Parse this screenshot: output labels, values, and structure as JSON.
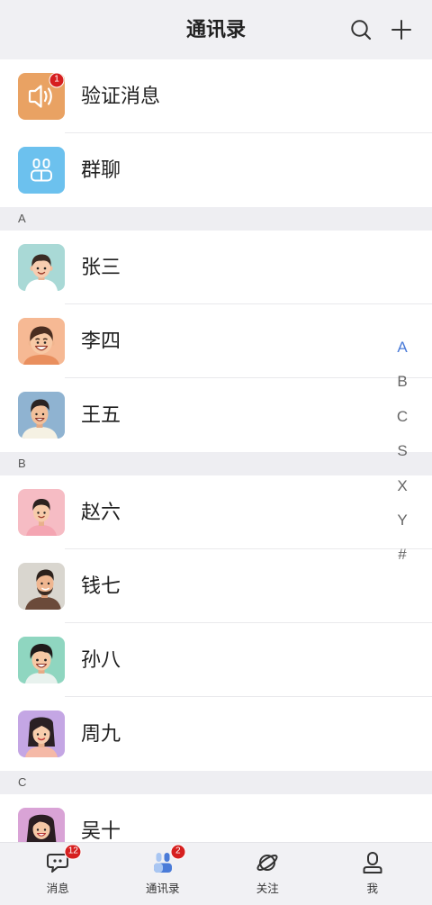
{
  "header": {
    "title": "通讯录",
    "search_icon": "search-icon",
    "add_icon": "plus-icon"
  },
  "special_items": [
    {
      "label": "验证消息",
      "badge": "1",
      "icon": "speaker-icon",
      "color": "#e9a263"
    },
    {
      "label": "群聊",
      "icon": "group-chat-icon",
      "color": "#6cc1ee"
    }
  ],
  "sections": [
    {
      "letter": "A",
      "contacts": [
        {
          "name": "张三",
          "avatar_bg": "#a9d9d6"
        },
        {
          "name": "李四",
          "avatar_bg": "#f6b994"
        },
        {
          "name": "王五",
          "avatar_bg": "#8fb3d1"
        }
      ]
    },
    {
      "letter": "B",
      "contacts": [
        {
          "name": "赵六",
          "avatar_bg": "#f6bcc4"
        },
        {
          "name": "钱七",
          "avatar_bg": "#d9d6cf"
        },
        {
          "name": "孙八",
          "avatar_bg": "#8fd6c0"
        },
        {
          "name": "周九",
          "avatar_bg": "#c4a6e4"
        }
      ]
    },
    {
      "letter": "C",
      "contacts": [
        {
          "name": "吴十",
          "avatar_bg": "#d9a3d6"
        }
      ]
    }
  ],
  "alphabet_index": [
    {
      "letter": "A",
      "active": true
    },
    {
      "letter": "B"
    },
    {
      "letter": "C"
    },
    {
      "letter": "S"
    },
    {
      "letter": "X"
    },
    {
      "letter": "Y"
    },
    {
      "letter": "#"
    }
  ],
  "tabs": [
    {
      "label": "消息",
      "icon": "chat-icon",
      "badge": "12"
    },
    {
      "label": "通讯录",
      "icon": "contacts-icon",
      "badge": "2",
      "active": true
    },
    {
      "label": "关注",
      "icon": "planet-icon"
    },
    {
      "label": "我",
      "icon": "user-icon"
    }
  ],
  "colors": {
    "accent": "#4a7bd8",
    "badge": "#d61f1f"
  }
}
